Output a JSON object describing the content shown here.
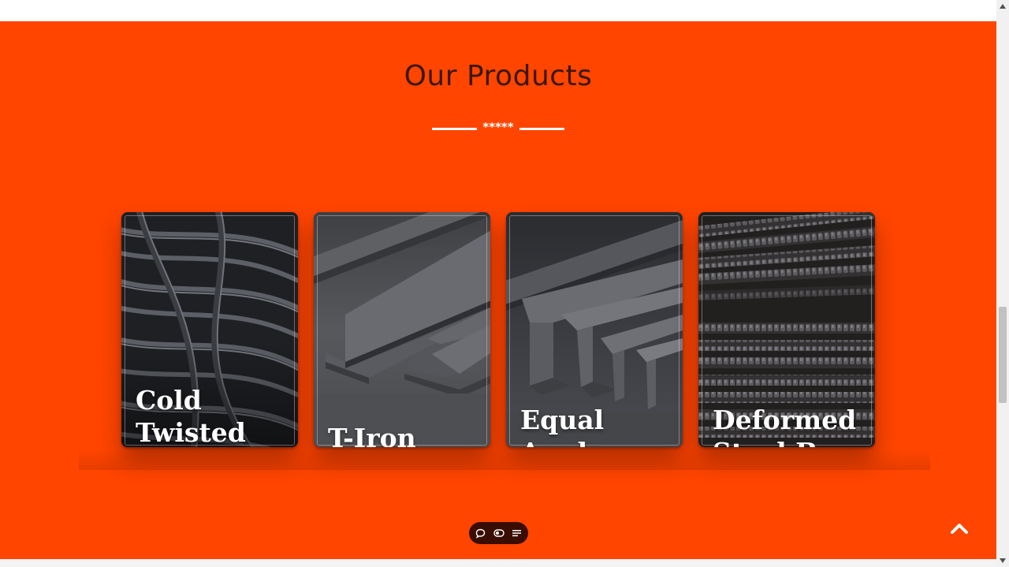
{
  "section": {
    "title": "Our Products",
    "divider_stars": "*****",
    "background_color": "#ff4500"
  },
  "products": [
    {
      "name": "Cold Twisted Bar",
      "image": "coiled-steel-wire-image"
    },
    {
      "name": "T-Iron Bars",
      "image": "t-iron-bars-image"
    },
    {
      "name": "Equal Angle Bars",
      "image": "angle-bars-image"
    },
    {
      "name": "Deformed Steel Bars",
      "image": "rebar-stack-image"
    }
  ],
  "floating_toolbar": {
    "icons": [
      "chat-bubble-icon",
      "toggle-icon",
      "menu-list-icon"
    ]
  },
  "back_to_top": {
    "icon": "chevron-up-icon"
  },
  "scrollbar": {
    "icons": [
      "scroll-up-arrow-icon",
      "scroll-down-arrow-icon"
    ]
  }
}
